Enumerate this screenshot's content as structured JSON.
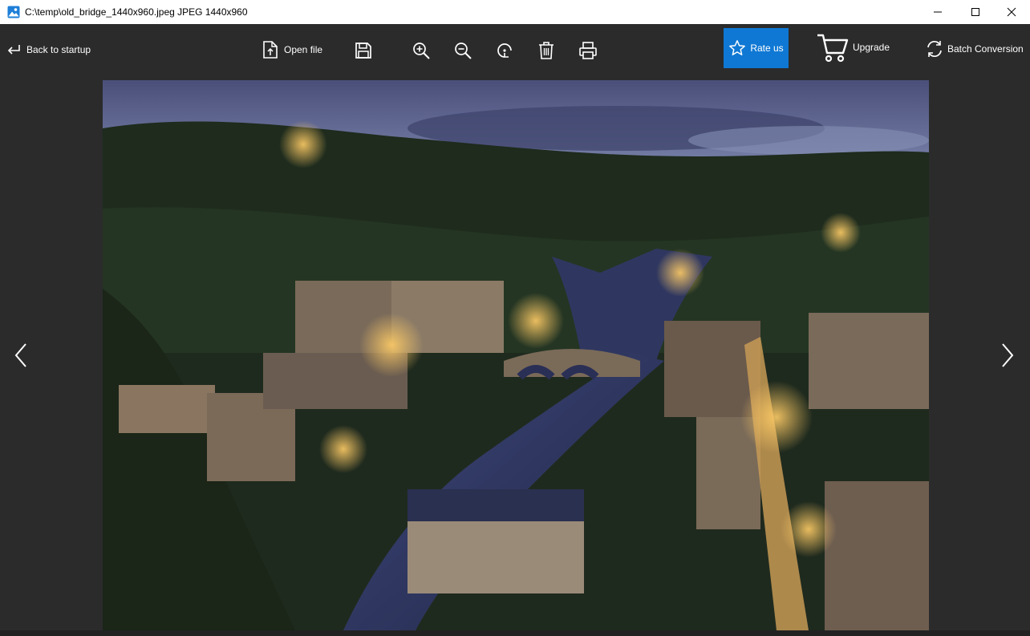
{
  "window": {
    "title": "C:\\temp\\old_bridge_1440x960.jpeg JPEG 1440x960",
    "app_icon": "image-icon",
    "controls": [
      "minimize-icon",
      "maximize-icon",
      "close-icon"
    ]
  },
  "toolbar": {
    "back_label": "Back to startup",
    "open_label": "Open file",
    "save_icon": "save-icon",
    "zoom_in_icon": "zoom-in-icon",
    "zoom_out_icon": "zoom-out-icon",
    "rotate_icon": "rotate-icon",
    "delete_icon": "trash-icon",
    "print_icon": "print-icon",
    "rate_label": "Rate us",
    "upgrade_label": "Upgrade",
    "batch_label": "Batch Conversion"
  },
  "viewer": {
    "prev_icon": "chevron-left-icon",
    "next_icon": "chevron-right-icon"
  },
  "colors": {
    "accent": "#0f78d4",
    "background": "#2b2b2b"
  }
}
